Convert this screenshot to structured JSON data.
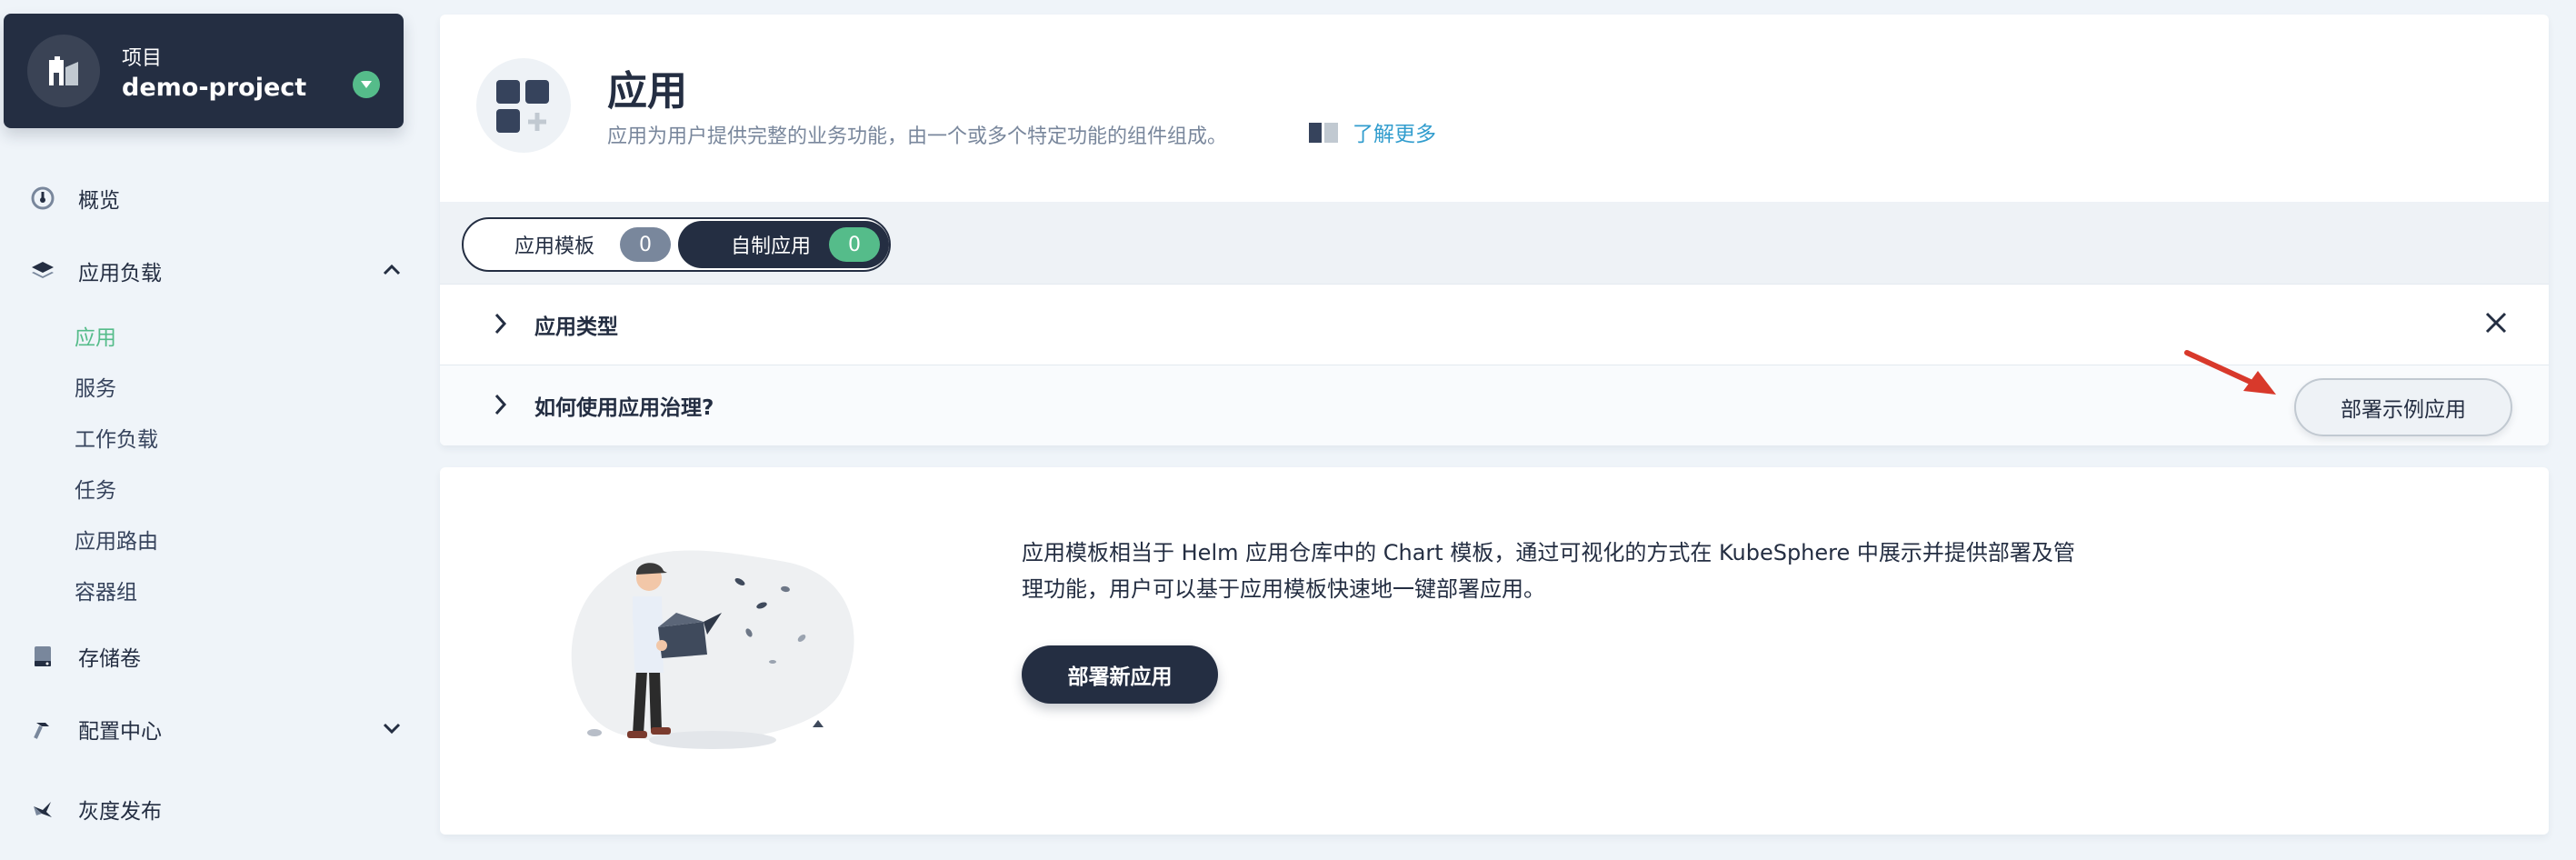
{
  "project": {
    "kicker": "项目",
    "name": "demo-project"
  },
  "sidebar": {
    "items": [
      {
        "label": "概览",
        "icon": "dashboard-icon"
      },
      {
        "label": "应用负载",
        "icon": "layers-icon",
        "expanded": true
      },
      {
        "label": "存储卷",
        "icon": "storage-icon"
      },
      {
        "label": "配置中心",
        "icon": "hammer-icon",
        "expanded": false
      },
      {
        "label": "灰度发布",
        "icon": "bird-icon"
      }
    ],
    "subitems": [
      "应用",
      "服务",
      "工作负载",
      "任务",
      "应用路由",
      "容器组"
    ],
    "active_subitem": "应用"
  },
  "header": {
    "title": "应用",
    "description": "应用为用户提供完整的业务功能，由一个或多个特定功能的组件组成。",
    "learn_more": "了解更多"
  },
  "tabs": [
    {
      "label": "应用模板",
      "count": "0",
      "selected": false
    },
    {
      "label": "自制应用",
      "count": "0",
      "selected": true
    }
  ],
  "info_rows": [
    {
      "label": "应用类型"
    },
    {
      "label": "如何使用应用治理?"
    }
  ],
  "actions": {
    "deploy_sample": "部署示例应用",
    "deploy_new": "部署新应用"
  },
  "intro": {
    "text": "应用模板相当于 Helm 应用仓库中的 Chart 模板，通过可视化的方式在 KubeSphere 中展示并提供部署及管理功能，用户可以基于应用模板快速地一键部署应用。"
  },
  "colors": {
    "primary_dark": "#242e42",
    "accent_green": "#55bc8a",
    "link_blue": "#329dce",
    "arrow_red": "#d8392b"
  }
}
